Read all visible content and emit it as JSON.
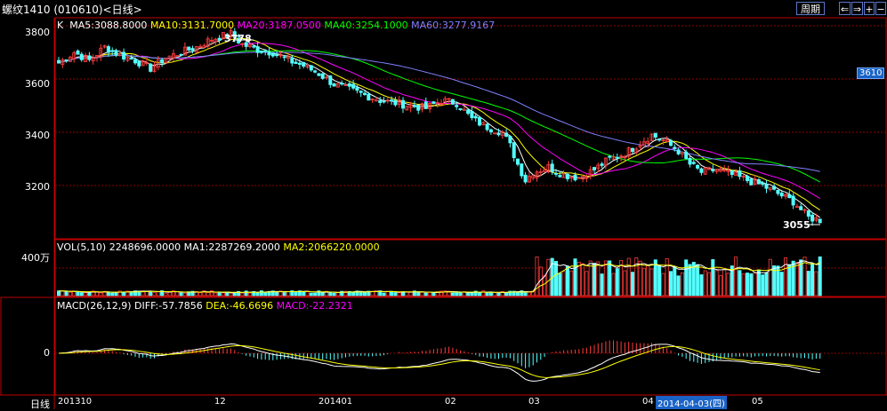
{
  "window": {
    "title": "螺纹1410 (010610)<日线>",
    "buttons": {
      "period": "周期",
      "left": "⇐",
      "right": "⇒",
      "plus": "+",
      "minus": "−"
    }
  },
  "main_panel": {
    "legend": {
      "k": "K",
      "ma5": "MA5:3088.8000",
      "ma10": "MA10:3131.7000",
      "ma20": "MA20:3187.0500",
      "ma40": "MA40:3254.1000",
      "ma60": "MA60:3277.9167"
    },
    "y_ticks": [
      "3800",
      "3600",
      "3400",
      "3200"
    ],
    "high_label": "3778",
    "low_label": "3055",
    "current_price_tag": "3610"
  },
  "volume_panel": {
    "legend": {
      "vol": "VOL(5,10)  2248696.0000",
      "ma1": "MA1:2287269.2000",
      "ma2": "MA2:2066220.0000"
    },
    "y_tick": "400万"
  },
  "macd_panel": {
    "legend": {
      "macd": "MACD(26,12,9)",
      "diff": "DIFF:-57.7856",
      "dea": "DEA:-46.6696",
      "macdv": "MACD:-22.2321"
    },
    "y_tick": "0"
  },
  "x_axis": {
    "period_label": "日线",
    "labels": [
      "201310",
      "12",
      "201401",
      "02",
      "03",
      "04",
      "05"
    ],
    "cursor_date": "2014-04-03(四)"
  },
  "colors": {
    "up": "#ff3c3c",
    "down": "#54ffff",
    "ma5": "#ffffff",
    "ma10": "#ffff00",
    "ma20": "#ff00ff",
    "ma40": "#00ff00",
    "ma60": "#8080ff",
    "grid": "#8b0000",
    "border": "#c00000"
  },
  "chart_data": {
    "type": "candlestick",
    "ylim": [
      3000,
      3830
    ],
    "close_anchors": [
      [
        0,
        3660
      ],
      [
        4,
        3700
      ],
      [
        8,
        3670
      ],
      [
        12,
        3720
      ],
      [
        16,
        3690
      ],
      [
        20,
        3670
      ],
      [
        24,
        3640
      ],
      [
        28,
        3680
      ],
      [
        32,
        3700
      ],
      [
        36,
        3720
      ],
      [
        40,
        3750
      ],
      [
        45,
        3770
      ],
      [
        48,
        3730
      ],
      [
        52,
        3710
      ],
      [
        56,
        3700
      ],
      [
        60,
        3670
      ],
      [
        64,
        3650
      ],
      [
        68,
        3620
      ],
      [
        72,
        3580
      ],
      [
        76,
        3560
      ],
      [
        80,
        3540
      ],
      [
        84,
        3520
      ],
      [
        88,
        3510
      ],
      [
        92,
        3500
      ],
      [
        96,
        3490
      ],
      [
        100,
        3520
      ],
      [
        104,
        3510
      ],
      [
        108,
        3450
      ],
      [
        112,
        3420
      ],
      [
        116,
        3400
      ],
      [
        118,
        3350
      ],
      [
        120,
        3280
      ],
      [
        122,
        3220
      ],
      [
        124,
        3250
      ],
      [
        128,
        3270
      ],
      [
        132,
        3240
      ],
      [
        136,
        3230
      ],
      [
        140,
        3260
      ],
      [
        144,
        3300
      ],
      [
        148,
        3320
      ],
      [
        152,
        3360
      ],
      [
        155,
        3390
      ],
      [
        158,
        3370
      ],
      [
        162,
        3330
      ],
      [
        165,
        3280
      ],
      [
        168,
        3250
      ],
      [
        172,
        3260
      ],
      [
        176,
        3240
      ],
      [
        180,
        3220
      ],
      [
        184,
        3200
      ],
      [
        188,
        3170
      ],
      [
        192,
        3140
      ],
      [
        196,
        3080
      ],
      [
        199,
        3070
      ]
    ],
    "ma_last": {
      "ma5": 3088.8,
      "ma10": 3131.7,
      "ma20": 3187.05,
      "ma40": 3254.1,
      "ma60": 3277.9167
    }
  }
}
